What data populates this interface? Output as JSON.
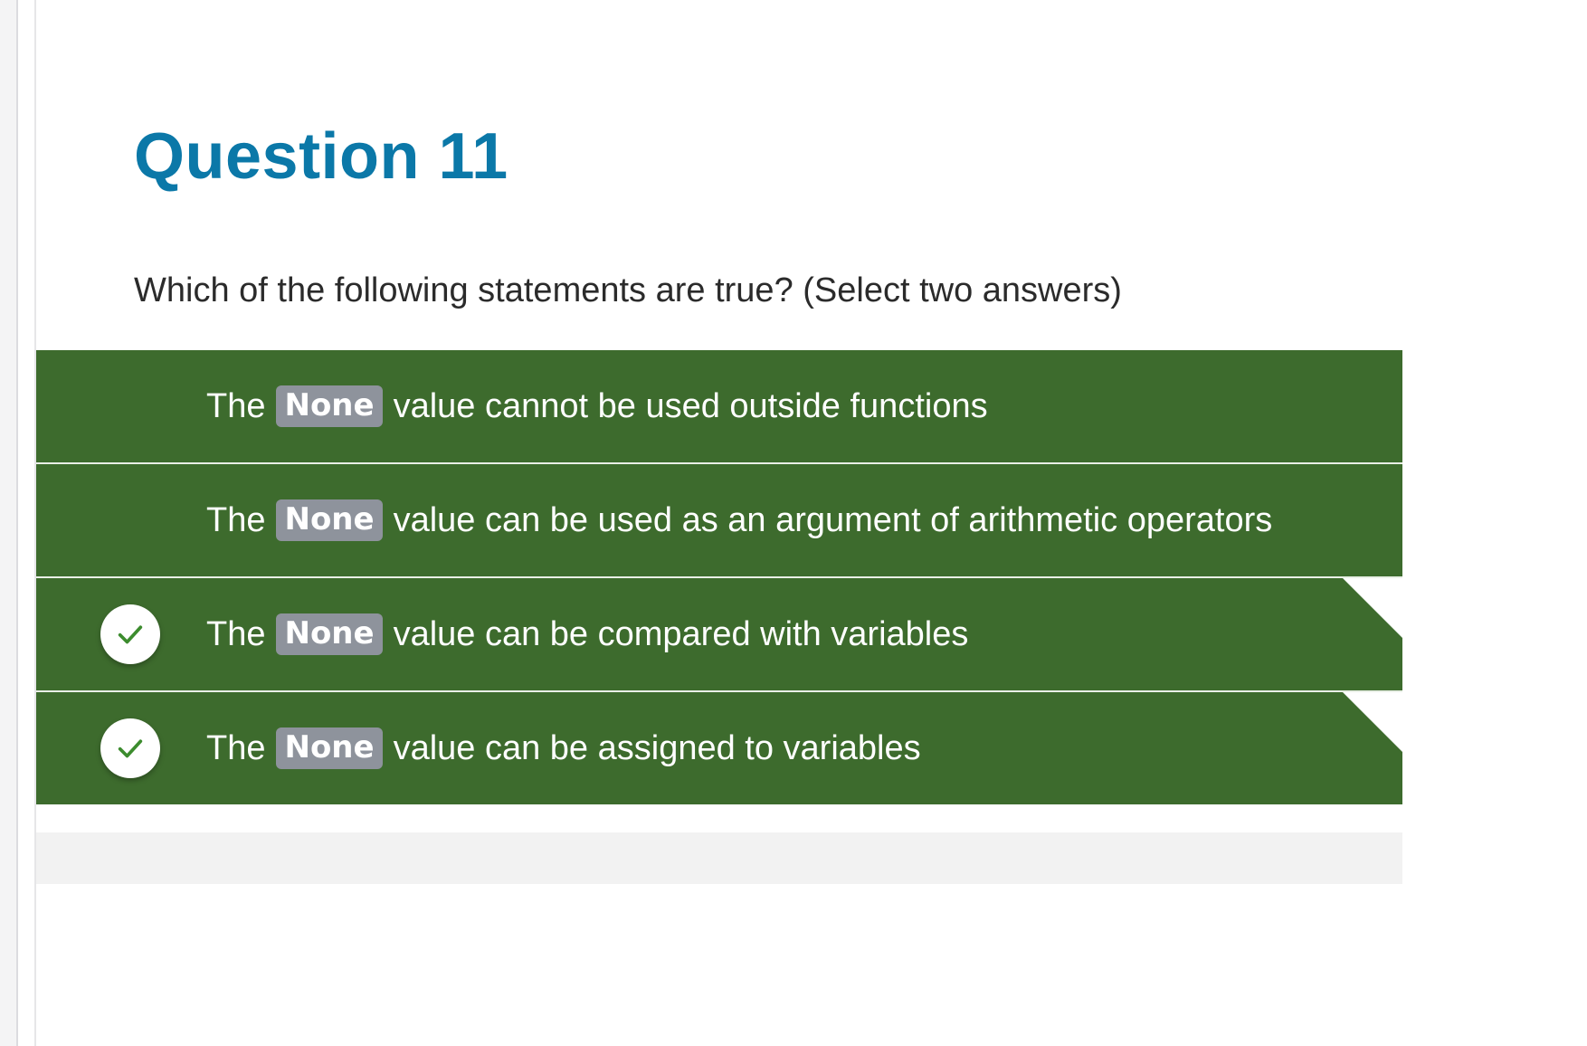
{
  "question": {
    "title": "Question 11",
    "prompt": "Which of the following statements are true? (Select two answers)"
  },
  "answers": [
    {
      "prefix": "The",
      "code": "None",
      "suffix": "value cannot be used outside functions",
      "selected": false
    },
    {
      "prefix": "The",
      "code": "None",
      "suffix": "value can be used as an argument of arithmetic operators",
      "selected": false
    },
    {
      "prefix": "The",
      "code": "None",
      "suffix": "value can be compared with variables",
      "selected": true
    },
    {
      "prefix": "The",
      "code": "None",
      "suffix": "value can be assigned to variables",
      "selected": true
    }
  ],
  "colors": {
    "title": "#0b78a8",
    "answer_bg": "#3d6b2d",
    "code_chip": "#8e939c",
    "check_mark": "#3c8c2e"
  },
  "icons": {
    "selected": "checkmark-icon"
  }
}
